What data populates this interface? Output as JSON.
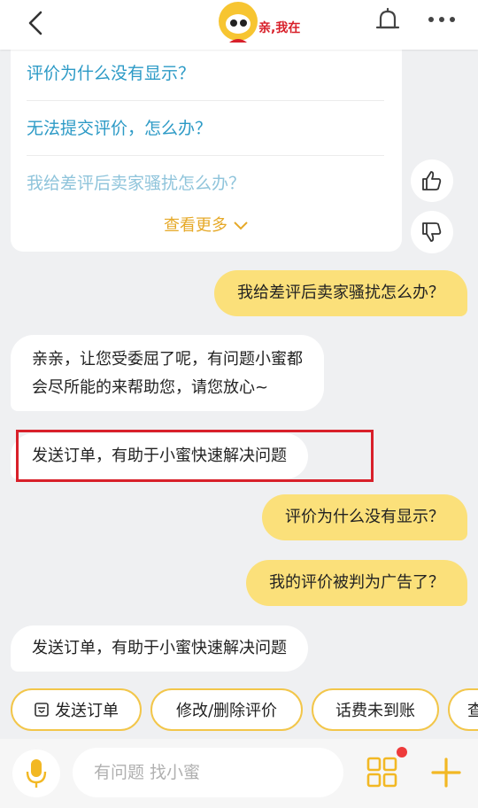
{
  "header": {
    "logo_text": "亲,我在"
  },
  "faq": {
    "items": [
      "评价为什么没有显示？",
      "无法提交评价，怎么办？",
      "我给差评后卖家骚扰怎么办？"
    ],
    "see_more": "查看更多"
  },
  "messages": [
    {
      "role": "user",
      "text": "我给差评后卖家骚扰怎么办？"
    },
    {
      "role": "bot",
      "lines": [
        "亲亲，让您受委屈了呢，有问题小蜜都",
        "会尽所能的来帮助您，请您放心~"
      ]
    },
    {
      "role": "bot",
      "text": "发送订单，有助于小蜜快速解决问题"
    },
    {
      "role": "user",
      "text": "评价为什么没有显示？"
    },
    {
      "role": "user",
      "text": "我的评价被判为广告了？"
    },
    {
      "role": "bot",
      "text": "发送订单，有助于小蜜快速解决问题"
    }
  ],
  "quick_replies": [
    "发送订单",
    "修改/删除评价",
    "话费未到账",
    "查"
  ],
  "input": {
    "placeholder": "有问题 找小蜜"
  },
  "colors": {
    "accent_yellow": "#fbe07a",
    "link_blue": "#2c9ac6",
    "highlight_red": "#d8202a"
  },
  "icons": [
    "back-arrow-icon",
    "bell-icon",
    "more-dots-icon",
    "thumbs-up-icon",
    "thumbs-down-icon",
    "order-icon",
    "mic-icon",
    "grid-icon",
    "plus-icon"
  ]
}
